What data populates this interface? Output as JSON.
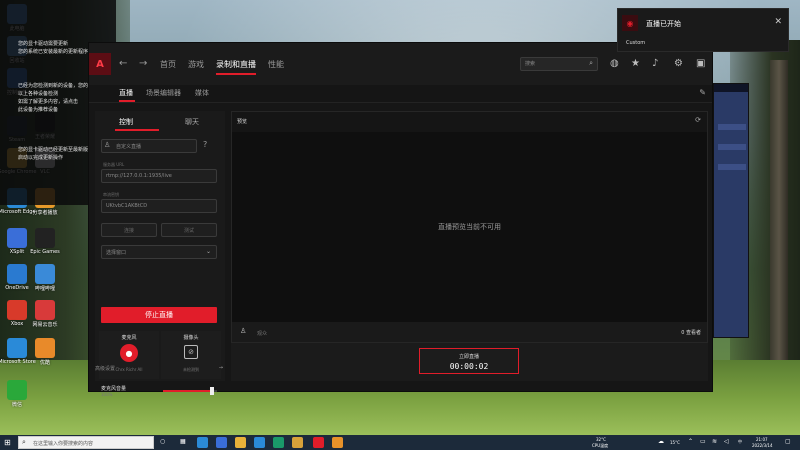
{
  "desktop": {
    "icons": [
      {
        "label": "此电脑",
        "color": "#4a8fd8"
      },
      {
        "label": "回收站",
        "color": "#5a9ad6"
      },
      {
        "label": "控制面板",
        "color": "#3a7bd0"
      },
      {
        "label": "Steam",
        "color": "#1b2838"
      },
      {
        "label": "Google Chrome",
        "color": "#e8b23a"
      },
      {
        "label": "Microsoft Edge",
        "color": "#2b8ad6"
      },
      {
        "label": "XSplit",
        "color": "#3a6ed8"
      },
      {
        "label": "OneDrive",
        "color": "#2a7ad0"
      },
      {
        "label": "Xbox",
        "color": "#d83a2a"
      },
      {
        "label": "Microsoft Store",
        "color": "#2a8ad8"
      },
      {
        "label": "微信",
        "color": "#2aa83a"
      },
      {
        "label": "王者荣耀",
        "color": "#1a1a1a"
      },
      {
        "label": "Epic Games",
        "color": "#222222"
      },
      {
        "label": "VLC",
        "color": "#e2e2e2"
      },
      {
        "label": "哔哩哔哩",
        "color": "#3a8ad8"
      },
      {
        "label": "网易云音乐",
        "color": "#d83a3a"
      },
      {
        "label": "优酷",
        "color": "#e88a2a"
      },
      {
        "label": "分享者播放",
        "color": "#e89a2a"
      }
    ],
    "notif_lines": [
      "您的显卡驱动需要更新",
      "您的系统已安装最新的更新程序",
      "已经为您检测到新的设备，您的设备大小",
      "以上各种设备检测",
      "如需了解更多内容，请点击",
      "此设备为推荐设备",
      "您的显卡驱动已经更新至最新版本，请重新",
      "启动以完成更新操作"
    ]
  },
  "app": {
    "logo": "A",
    "nav": {
      "back": "←",
      "forward": "→",
      "tabs": [
        "首页",
        "游戏",
        "录制和直播",
        "性能"
      ]
    },
    "search_placeholder": "搜索",
    "sub_tabs": [
      "直播",
      "场景编辑器",
      "媒体"
    ],
    "left_tabs": [
      "控制",
      "聊天"
    ],
    "fields": {
      "title": "自定义直播",
      "server_label": "服务器 URL",
      "server": "rtmp://127.0.0.1:1935/live",
      "key_label": "串流密钥",
      "key": "UKtvbC1AKBtCD"
    },
    "ghost_buttons": [
      "连接",
      "测试"
    ],
    "window_select": "选择窗口",
    "stop_button": "停止直播",
    "mic": {
      "title": "麦克风",
      "device": "Chrx Richr All"
    },
    "camera": {
      "title": "摄像头",
      "device": "未检测到"
    },
    "volume": {
      "label": "麦克风音量",
      "value": "100%",
      "level": 0.9
    },
    "advanced": "高级设置",
    "preview": {
      "title": "预览",
      "message": "直播预览当前不可用",
      "viewer_label": "观众",
      "viewer_count": "0 查看者"
    },
    "record": {
      "label": "立即直播",
      "time": "00:00:02"
    }
  },
  "toast": {
    "title": "直播已开始",
    "subtitle": "Custom"
  },
  "taskbar": {
    "search_text": "在这里输入你要搜索的内容",
    "cpu_temp": "32°C",
    "cpu_label": "CPU温度",
    "weather": "15°C",
    "ime": "中",
    "time": "21:07",
    "date": "2022/3/14"
  }
}
